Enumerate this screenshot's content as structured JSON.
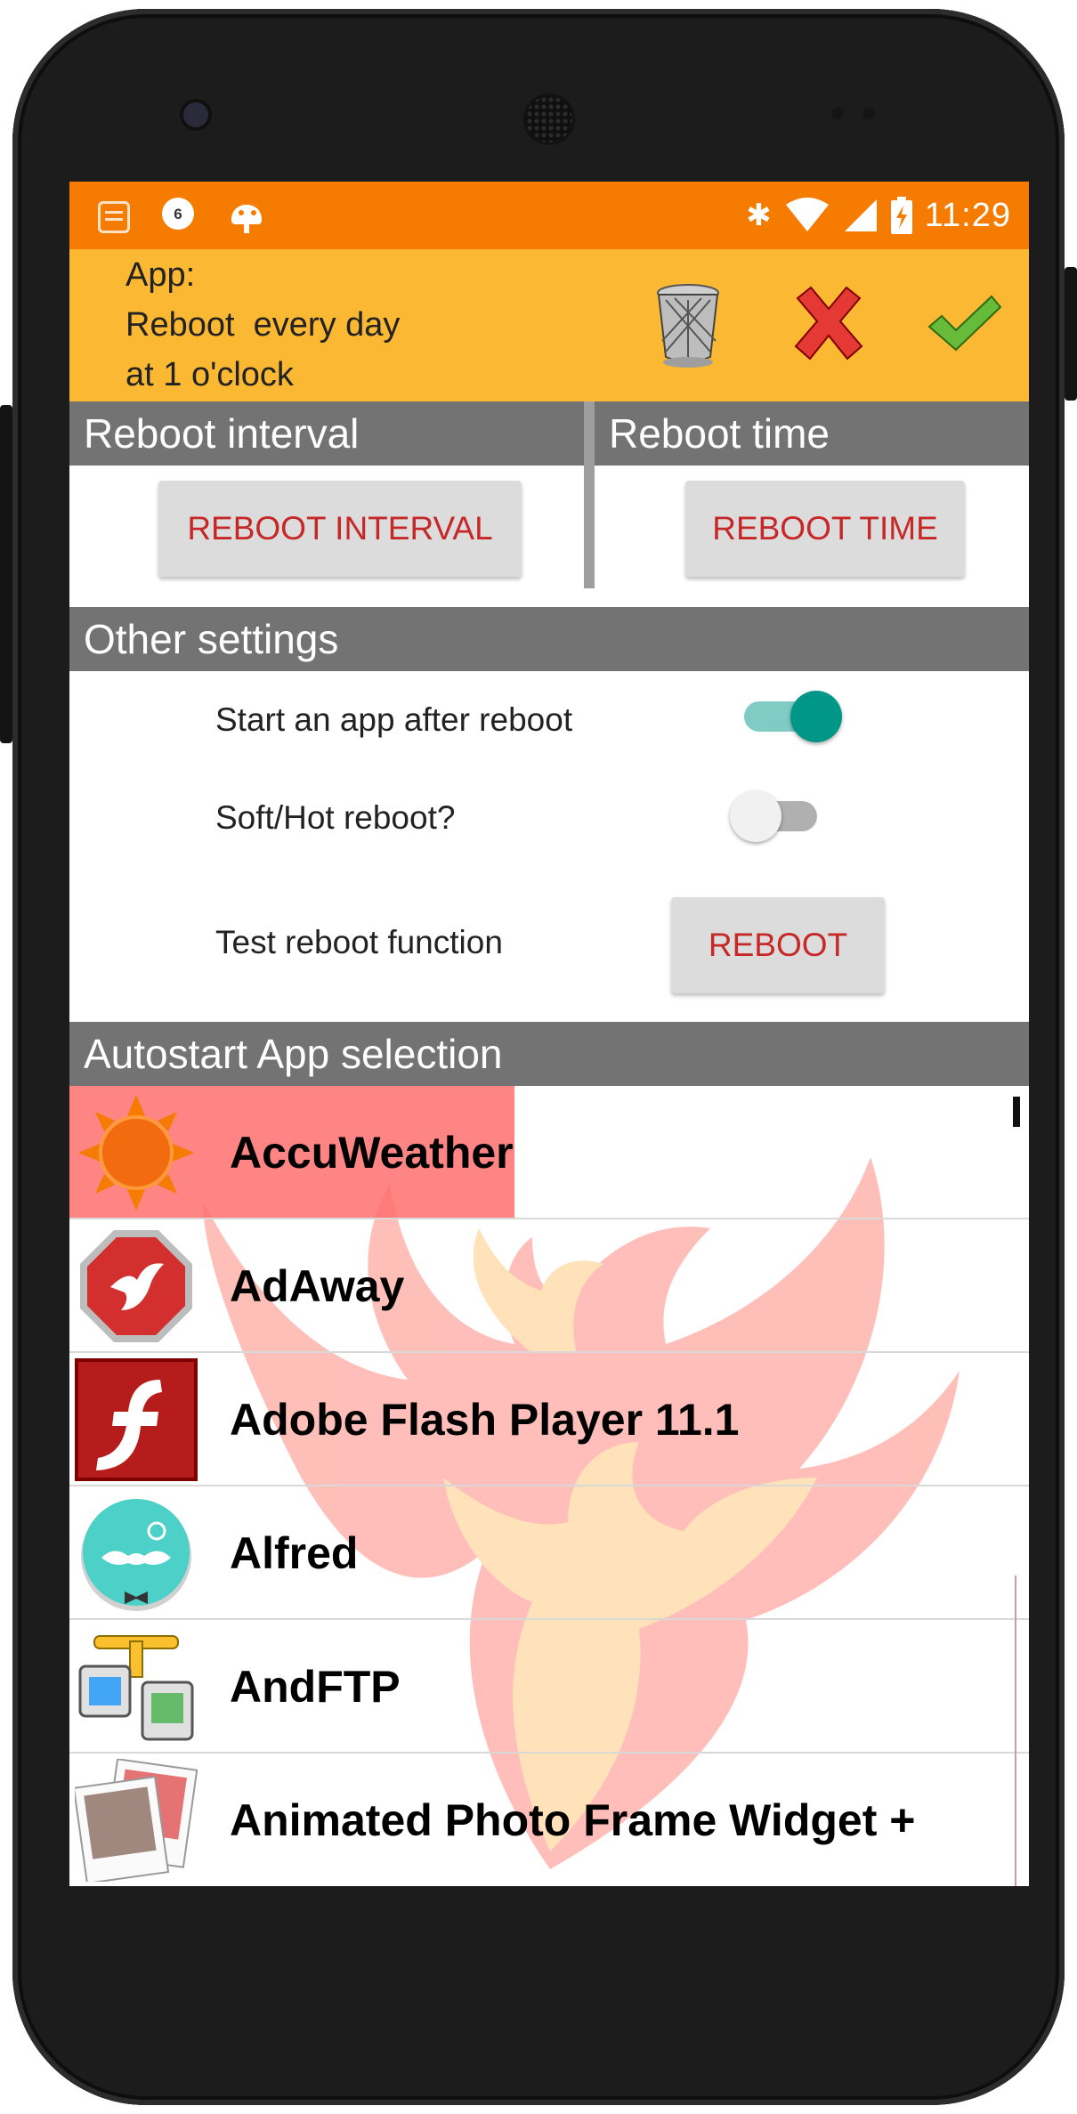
{
  "status_bar": {
    "notification_badge": "6",
    "time": "11:29",
    "icons": [
      "notes-icon",
      "badge-icon",
      "android-icon",
      "bluetooth-icon",
      "wifi-icon",
      "signal-icon",
      "battery-icon"
    ]
  },
  "header": {
    "line1": "App:",
    "line2": "Reboot  every day",
    "line3": "at 1 o'clock",
    "actions": [
      "trash-icon",
      "cancel-icon",
      "confirm-icon"
    ]
  },
  "reboot_interval": {
    "title": "Reboot interval",
    "button": "REBOOT INTERVAL"
  },
  "reboot_time": {
    "title": "Reboot time",
    "button": "REBOOT TIME"
  },
  "other_settings": {
    "title": "Other settings",
    "start_app_label": "Start an app after reboot",
    "start_app_enabled": true,
    "soft_reboot_label": "Soft/Hot reboot?",
    "soft_reboot_enabled": false,
    "test_label": "Test reboot function",
    "test_button": "REBOOT"
  },
  "autostart": {
    "title": "Autostart App selection",
    "apps": [
      {
        "name": "AccuWeather",
        "icon": "accuweather-icon",
        "selected": true
      },
      {
        "name": "AdAway",
        "icon": "adaway-icon",
        "selected": false
      },
      {
        "name": "Adobe Flash Player 11.1",
        "icon": "flash-icon",
        "selected": false
      },
      {
        "name": "Alfred",
        "icon": "alfred-icon",
        "selected": false
      },
      {
        "name": "AndFTP",
        "icon": "andftp-icon",
        "selected": false
      },
      {
        "name": "Animated Photo Frame Widget +",
        "icon": "photo-frame-icon",
        "selected": false
      }
    ]
  },
  "colors": {
    "status_bar": "#f57c00",
    "header": "#fbb833",
    "section": "#737373",
    "button_text": "#c62828",
    "switch_on": "#009688",
    "highlight": "#ff6f6f"
  }
}
